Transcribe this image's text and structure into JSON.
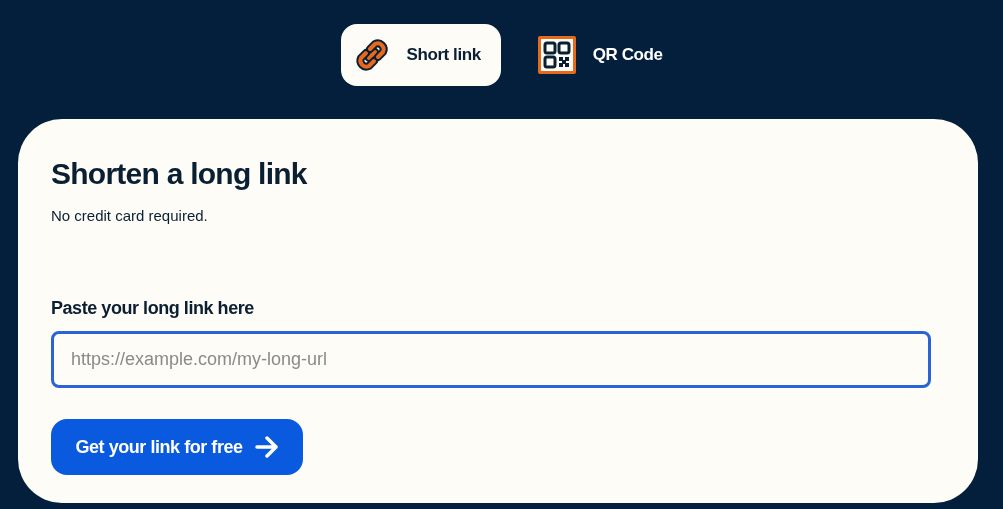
{
  "tabs": [
    {
      "label": "Short link",
      "kind": "link",
      "selected": true
    },
    {
      "label": "QR Code",
      "kind": "qr",
      "selected": false
    }
  ],
  "card": {
    "title": "Shorten a long link",
    "subtitle": "No credit card required.",
    "field": {
      "label": "Paste your long link here",
      "placeholder": "https://example.com/my-long-url"
    },
    "button": {
      "label": "Get your link for free"
    }
  }
}
